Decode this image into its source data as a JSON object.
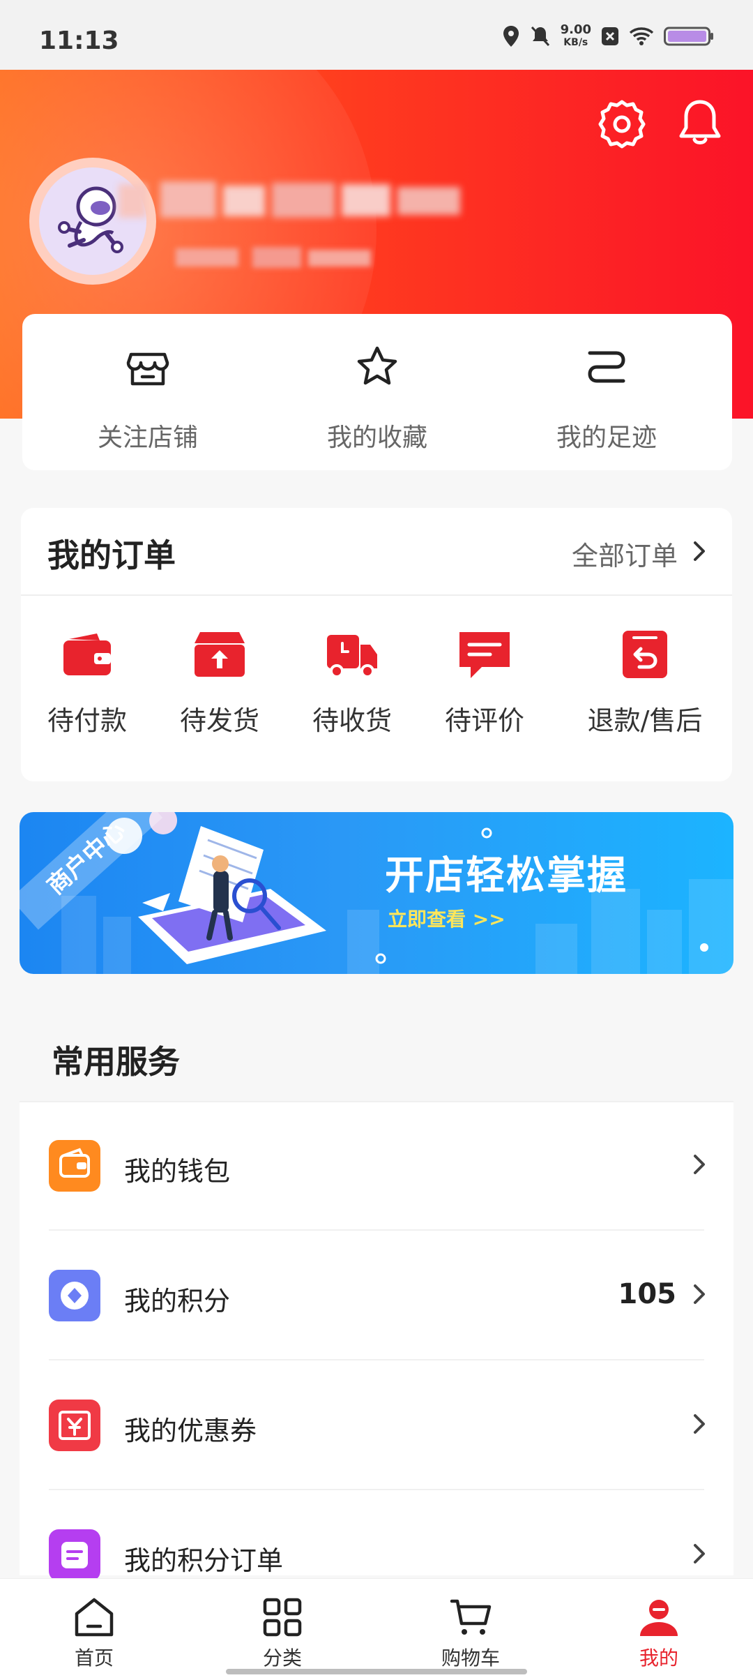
{
  "status_bar": {
    "time": "11:13",
    "speed_value": "9.00",
    "speed_unit": "KB/s"
  },
  "header": {
    "settings_icon": "gear-icon",
    "notification_icon": "bell-icon"
  },
  "quick_links": [
    {
      "label": "关注店铺",
      "icon": "store-icon"
    },
    {
      "label": "我的收藏",
      "icon": "star-icon"
    },
    {
      "label": "我的足迹",
      "icon": "footprint-icon"
    }
  ],
  "orders": {
    "title": "我的订单",
    "all_label": "全部订单",
    "items": [
      {
        "label": "待付款",
        "icon": "wallet-icon"
      },
      {
        "label": "待发货",
        "icon": "ship-box-icon"
      },
      {
        "label": "待收货",
        "icon": "truck-icon"
      },
      {
        "label": "待评价",
        "icon": "comment-icon"
      },
      {
        "label": "退款/售后",
        "icon": "refund-icon"
      }
    ]
  },
  "banner": {
    "stamp": "商户中心",
    "title": "开店轻松掌握",
    "subtitle": "立即查看 >>"
  },
  "services": {
    "title": "常用服务",
    "items": [
      {
        "label": "我的钱包",
        "value": "",
        "icon": "wallet-icon",
        "color": "#ff8a1f"
      },
      {
        "label": "我的积分",
        "value": "105",
        "icon": "points-icon",
        "color": "#6b7ef5"
      },
      {
        "label": "我的优惠券",
        "value": "",
        "icon": "coupon-icon",
        "color": "#f03a45"
      },
      {
        "label": "我的积分订单",
        "value": "",
        "icon": "order-icon",
        "color": "#b53ef0"
      }
    ]
  },
  "tabbar": {
    "items": [
      {
        "label": "首页",
        "icon": "home-icon"
      },
      {
        "label": "分类",
        "icon": "grid-icon"
      },
      {
        "label": "购物车",
        "icon": "cart-icon"
      },
      {
        "label": "我的",
        "icon": "profile-icon"
      }
    ],
    "active": "我的"
  },
  "colors": {
    "accent": "#e8232d",
    "header_start": "#ff6a1a",
    "header_end": "#fb1328"
  }
}
